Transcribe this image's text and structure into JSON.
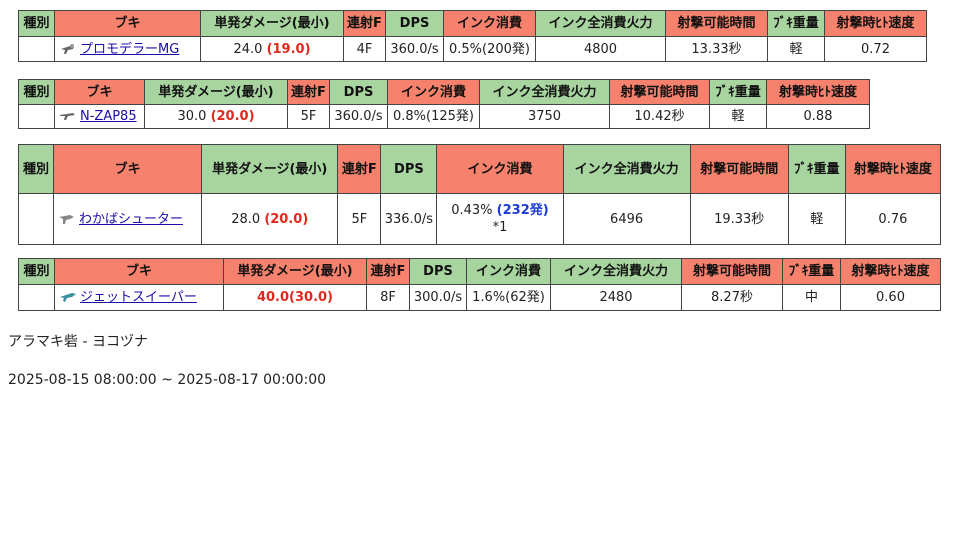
{
  "tables": [
    {
      "headers": [
        "種別",
        "ブキ",
        "単発ダメージ(最小)",
        "連射F",
        "DPS",
        "インク消費",
        "インク全消費火力",
        "射撃可能時間",
        "ﾌﾞｷ重量",
        "射撃時ﾋﾄ速度"
      ],
      "row": {
        "type": "",
        "icon": "pro-mode-gun-icon",
        "weapon": "プロモデラーMG",
        "damage": "24.0",
        "damage_min": "(19.0)",
        "fire_rate": "4F",
        "dps": "360.0/s",
        "ink": "0.5%(200発)",
        "ink_total_power": "4800",
        "fire_time": "13.33秒",
        "weight": "軽",
        "speed": "0.72"
      }
    },
    {
      "headers": [
        "種別",
        "ブキ",
        "単発ダメージ(最小)",
        "連射F",
        "DPS",
        "インク消費",
        "インク全消費火力",
        "射撃可能時間",
        "ﾌﾞｷ重量",
        "射撃時ﾋﾄ速度"
      ],
      "row": {
        "type": "",
        "icon": "zap-gun-icon",
        "weapon": "N-ZAP85",
        "damage": "30.0",
        "damage_min": "(20.0)",
        "fire_rate": "5F",
        "dps": "360.0/s",
        "ink": "0.8%(125発)",
        "ink_total_power": "3750",
        "fire_time": "10.42秒",
        "weight": "軽",
        "speed": "0.88"
      }
    },
    {
      "headers": [
        "種別",
        "ブキ",
        "単発ダメージ(最小)",
        "連射F",
        "DPS",
        "インク消費",
        "インク全消費火力",
        "射撃可能時間",
        "ﾌﾞｷ重量",
        "射撃時ﾋﾄ速度"
      ],
      "row": {
        "type": "",
        "icon": "splattershot-jr-icon",
        "weapon": "わかばシューター",
        "damage": "28.0",
        "damage_min": "(20.0)",
        "fire_rate": "5F",
        "dps": "336.0/s",
        "ink_pct": "0.43%",
        "ink_shots": "(232発)",
        "ink_note": "*1",
        "ink_total_power": "6496",
        "fire_time": "19.33秒",
        "weight": "軽",
        "speed": "0.76"
      }
    },
    {
      "headers": [
        "種別",
        "ブキ",
        "単発ダメージ(最小)",
        "連射F",
        "DPS",
        "インク消費",
        "インク全消費火力",
        "射撃可能時間",
        "ﾌﾞｷ重量",
        "射撃時ﾋﾄ速度"
      ],
      "row": {
        "type": "",
        "icon": "jet-squelcher-icon",
        "weapon": "ジェットスイーパー",
        "damage_full": "40.0(30.0)",
        "fire_rate": "8F",
        "dps": "300.0/s",
        "ink": "1.6%(62発)",
        "ink_total_power": "2480",
        "fire_time": "8.27秒",
        "weight": "中",
        "speed": "0.60"
      }
    }
  ],
  "stage_line": "アラマキ砦 - ヨコヅナ",
  "period": "2025-08-15 08:00:00 ~ 2025-08-17 00:00:00"
}
